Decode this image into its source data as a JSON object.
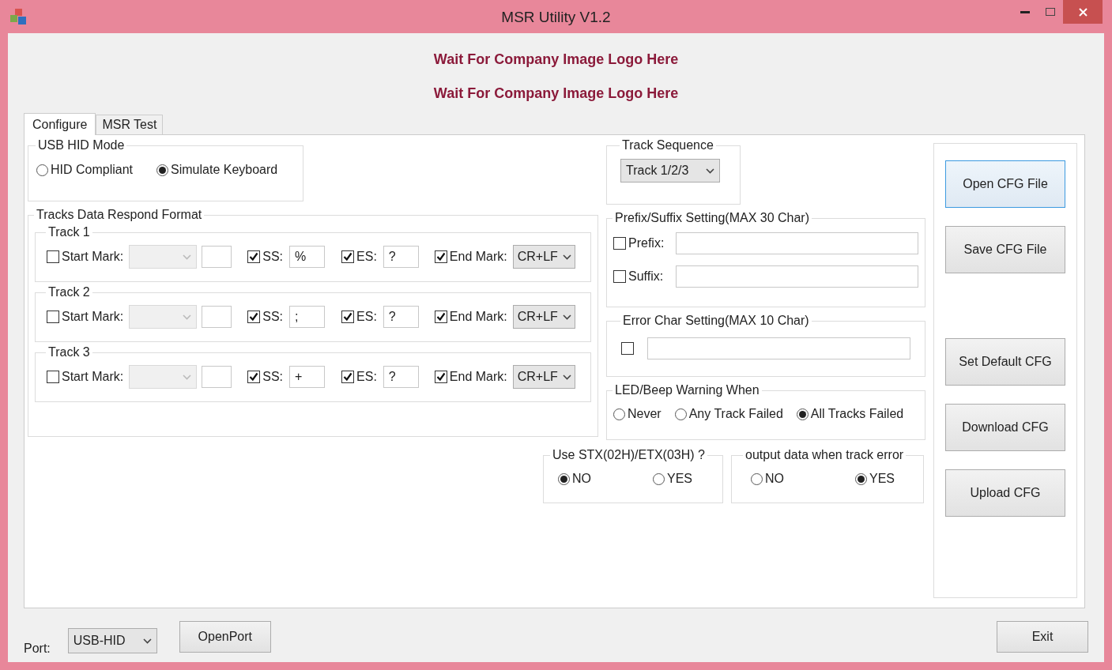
{
  "window": {
    "title": "MSR Utility V1.2"
  },
  "logo_lines": [
    "Wait For Company Image Logo Here",
    "Wait For Company Image Logo Here"
  ],
  "tabs": [
    {
      "label": "Configure",
      "selected": true
    },
    {
      "label": "MSR Test",
      "selected": false
    }
  ],
  "usb_hid_mode": {
    "title": "USB HID Mode",
    "options": [
      {
        "label": "HID Compliant",
        "selected": false
      },
      {
        "label": "Simulate Keyboard",
        "selected": true
      }
    ]
  },
  "tracks_format": {
    "title": "Tracks Data Respond Format",
    "tracks": [
      {
        "title": "Track 1",
        "start_mark": {
          "label": "Start Mark:",
          "checked": false,
          "disabled": true
        },
        "ss": {
          "label": "SS:",
          "checked": true,
          "value": "%"
        },
        "es": {
          "label": "ES:",
          "checked": true,
          "value": "?"
        },
        "end_mark": {
          "label": "End Mark:",
          "checked": true,
          "value": "CR+LF"
        }
      },
      {
        "title": "Track 2",
        "start_mark": {
          "label": "Start Mark:",
          "checked": false,
          "disabled": true
        },
        "ss": {
          "label": "SS:",
          "checked": true,
          "value": ";"
        },
        "es": {
          "label": "ES:",
          "checked": true,
          "value": "?"
        },
        "end_mark": {
          "label": "End Mark:",
          "checked": true,
          "value": "CR+LF"
        }
      },
      {
        "title": "Track 3",
        "start_mark": {
          "label": "Start Mark:",
          "checked": false,
          "disabled": true
        },
        "ss": {
          "label": "SS:",
          "checked": true,
          "value": "+"
        },
        "es": {
          "label": "ES:",
          "checked": true,
          "value": "?"
        },
        "end_mark": {
          "label": "End Mark:",
          "checked": true,
          "value": "CR+LF"
        }
      }
    ]
  },
  "track_sequence": {
    "title": "Track Sequence",
    "value": "Track 1/2/3"
  },
  "prefix_suffix": {
    "title": "Prefix/Suffix Setting(MAX 30 Char)",
    "fields": [
      {
        "label": "Prefix:",
        "checked": false
      },
      {
        "label": "Suffix:",
        "checked": false
      }
    ]
  },
  "error_char": {
    "title": "Error Char Setting(MAX 10 Char)",
    "checked": false
  },
  "led_beep": {
    "title": "LED/Beep Warning When",
    "options": [
      {
        "label": "Never",
        "selected": false
      },
      {
        "label": "Any Track Failed",
        "selected": false
      },
      {
        "label": "All Tracks Failed",
        "selected": true
      }
    ]
  },
  "stx_etx": {
    "title": "Use STX(02H)/ETX(03H) ?",
    "options": [
      {
        "label": "NO",
        "selected": true
      },
      {
        "label": "YES",
        "selected": false
      }
    ]
  },
  "output_on_error": {
    "title": "output data when track error",
    "options": [
      {
        "label": "NO",
        "selected": false
      },
      {
        "label": "YES",
        "selected": true
      }
    ]
  },
  "side_buttons": [
    {
      "label": "Open CFG File",
      "focused": true
    },
    {
      "label": "Save CFG File",
      "focused": false
    },
    {
      "label": "Set Default CFG",
      "focused": false
    },
    {
      "label": "Download CFG",
      "focused": false
    },
    {
      "label": "Upload CFG",
      "focused": false
    }
  ],
  "port": {
    "label": "Port:",
    "value": "USB-HID"
  },
  "open_port_button": "OpenPort",
  "exit_button": "Exit"
}
